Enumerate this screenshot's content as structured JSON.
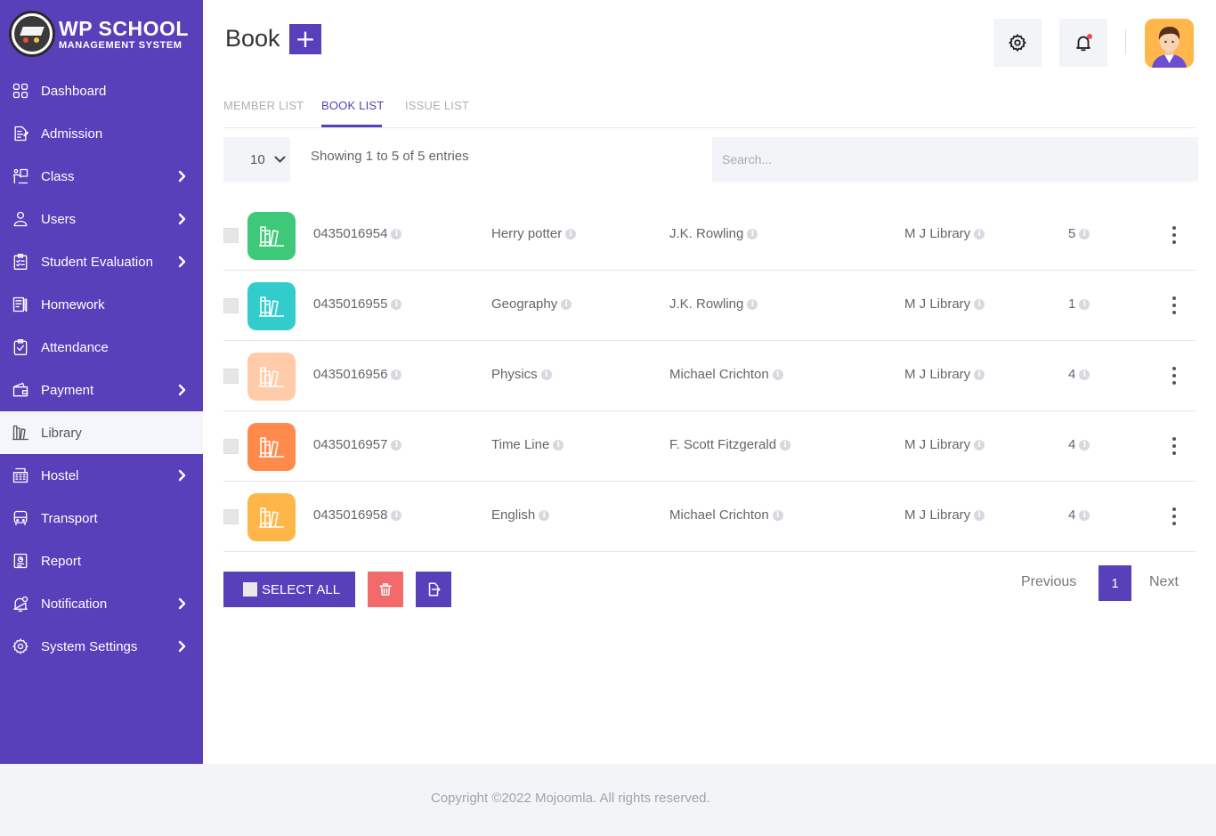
{
  "brand": {
    "title": "WP SCHOOL",
    "subtitle": "MANAGEMENT SYSTEM"
  },
  "sidebar": {
    "items": [
      {
        "label": "Dashboard",
        "icon": "dashboard-icon",
        "has_arrow": false,
        "active": false
      },
      {
        "label": "Admission",
        "icon": "admission-icon",
        "has_arrow": false,
        "active": false
      },
      {
        "label": "Class",
        "icon": "class-icon",
        "has_arrow": true,
        "active": false
      },
      {
        "label": "Users",
        "icon": "user-icon",
        "has_arrow": true,
        "active": false
      },
      {
        "label": "Student Evaluation",
        "icon": "evaluation-icon",
        "has_arrow": true,
        "active": false
      },
      {
        "label": "Homework",
        "icon": "homework-icon",
        "has_arrow": false,
        "active": false
      },
      {
        "label": "Attendance",
        "icon": "attendance-icon",
        "has_arrow": false,
        "active": false
      },
      {
        "label": "Payment",
        "icon": "wallet-icon",
        "has_arrow": true,
        "active": false
      },
      {
        "label": "Library",
        "icon": "library-icon",
        "has_arrow": false,
        "active": true
      },
      {
        "label": "Hostel",
        "icon": "hostel-icon",
        "has_arrow": true,
        "active": false
      },
      {
        "label": "Transport",
        "icon": "bus-icon",
        "has_arrow": false,
        "active": false
      },
      {
        "label": "Report",
        "icon": "report-icon",
        "has_arrow": false,
        "active": false
      },
      {
        "label": "Notification",
        "icon": "notification-icon",
        "has_arrow": true,
        "active": false
      },
      {
        "label": "System Settings",
        "icon": "settings-icon",
        "has_arrow": true,
        "active": false
      }
    ]
  },
  "header": {
    "title": "Book",
    "add_label": "+"
  },
  "tabs": [
    {
      "label": "MEMBER LIST",
      "active": false
    },
    {
      "label": "BOOK LIST",
      "active": true
    },
    {
      "label": "ISSUE LIST",
      "active": false
    }
  ],
  "controls": {
    "page_size": "10",
    "showing": "Showing 1 to 5 of 5 entries",
    "search_placeholder": "Search..."
  },
  "books": [
    {
      "isbn": "0435016954",
      "title": "Herry potter",
      "author": "J.K. Rowling",
      "library": "M J Library",
      "quantity": "5",
      "icon_color": "#3ec97a"
    },
    {
      "isbn": "0435016955",
      "title": "Geography",
      "author": "J.K. Rowling",
      "library": "M J Library",
      "quantity": "1",
      "icon_color": "#33cccc"
    },
    {
      "isbn": "0435016956",
      "title": "Physics",
      "author": "Michael Crichton",
      "library": "M J Library",
      "quantity": "4",
      "icon_color": "#ffcba8"
    },
    {
      "isbn": "0435016957",
      "title": "Time Line",
      "author": "F. Scott Fitzgerald",
      "library": "M J Library",
      "quantity": "4",
      "icon_color": "#ff8a4c"
    },
    {
      "isbn": "0435016958",
      "title": "English",
      "author": "Michael Crichton",
      "library": "M J Library",
      "quantity": "4",
      "icon_color": "#ffb648"
    }
  ],
  "actions": {
    "select_all": "SELECT ALL"
  },
  "pagination": {
    "previous": "Previous",
    "current": "1",
    "next": "Next"
  },
  "footer": {
    "copyright": "Copyright ©2022 Mojoomla. All rights reserved."
  },
  "colors": {
    "primary": "#5840bb",
    "danger": "#f26a6a",
    "light_bg": "#f2f4f8"
  }
}
